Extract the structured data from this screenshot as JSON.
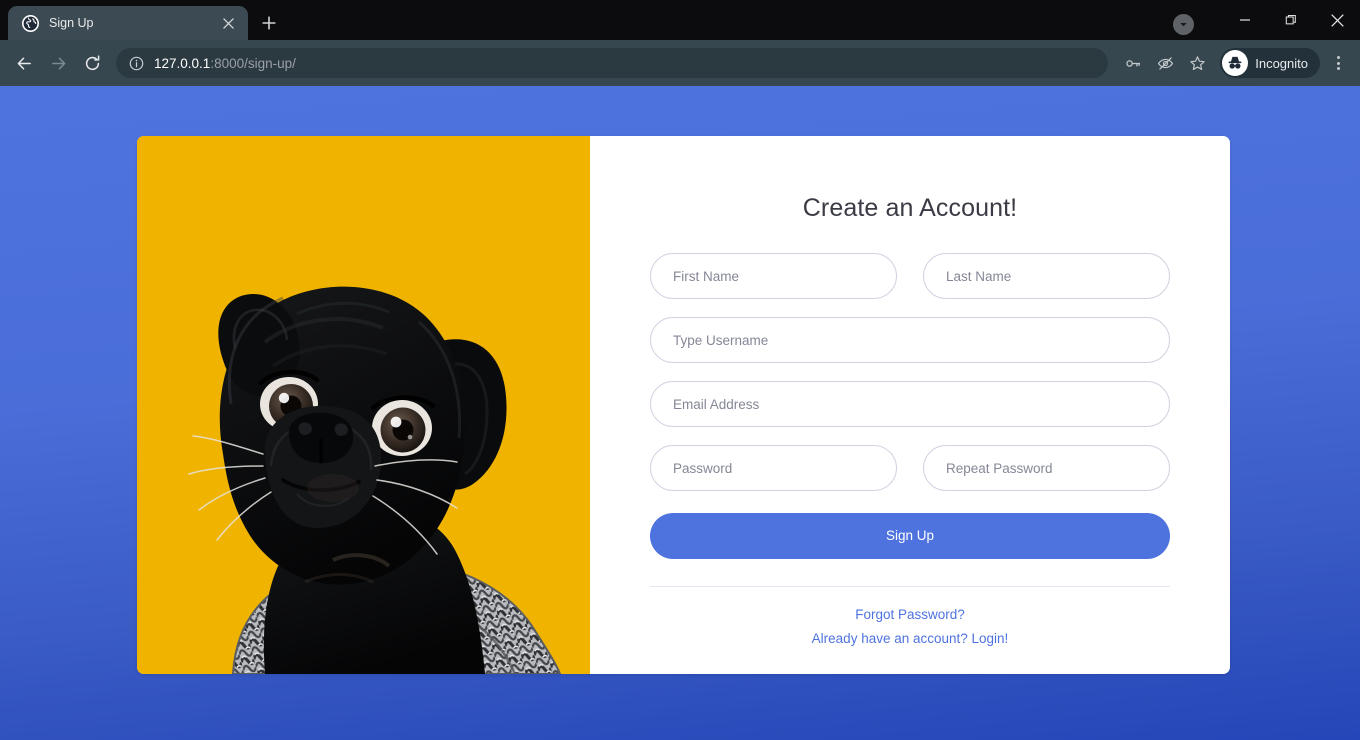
{
  "browser": {
    "tab": {
      "title": "Sign Up",
      "favicon_name": "globe-favicon",
      "close_glyph": "✕"
    },
    "new_tab_glyph": "+",
    "window_controls": {
      "download_glyph": "▾",
      "minimize_glyph": "─",
      "maximize_glyph": "❐",
      "close_glyph": "✕"
    },
    "nav": {
      "back_glyph": "←",
      "forward_glyph": "→",
      "reload_glyph": "⟳"
    },
    "omnibox": {
      "info_icon": "info-circle-icon",
      "url_host": "127.0.0.1",
      "url_rest": ":8000/sign-up/",
      "full_url": "127.0.0.1:8000/sign-up/"
    },
    "toolbar_icons": [
      {
        "name": "password-key-icon"
      },
      {
        "name": "eye-slash-icon"
      },
      {
        "name": "bookmark-star-icon"
      }
    ],
    "profile": {
      "label": "Incognito",
      "avatar_name": "incognito-hat-glasses-icon"
    },
    "menu_name": "chrome-menu-icon"
  },
  "page": {
    "background_top_color": "#4e73df",
    "background_bottom_color": "#2446b8",
    "image_panel": {
      "name": "pug-photo",
      "background_color": "#f0b400",
      "description": "black pug wearing a grey knitted scarf"
    },
    "form": {
      "title": "Create an Account!",
      "fields": [
        {
          "name": "first-name-field",
          "placeholder": "First Name",
          "value": ""
        },
        {
          "name": "last-name-field",
          "placeholder": "Last Name",
          "value": ""
        },
        {
          "name": "username-field",
          "placeholder": "Type Username",
          "value": ""
        },
        {
          "name": "email-field",
          "placeholder": "Email Address",
          "value": ""
        },
        {
          "name": "password-field",
          "placeholder": "Password",
          "value": ""
        },
        {
          "name": "repeat-password-field",
          "placeholder": "Repeat Password",
          "value": ""
        }
      ],
      "submit_label": "Sign Up",
      "submit_color": "#4e73df",
      "links": [
        {
          "name": "forgot-password-link",
          "label": "Forgot Password?"
        },
        {
          "name": "login-link",
          "label": "Already have an account? Login!"
        }
      ],
      "link_color": "#4e73df"
    }
  }
}
